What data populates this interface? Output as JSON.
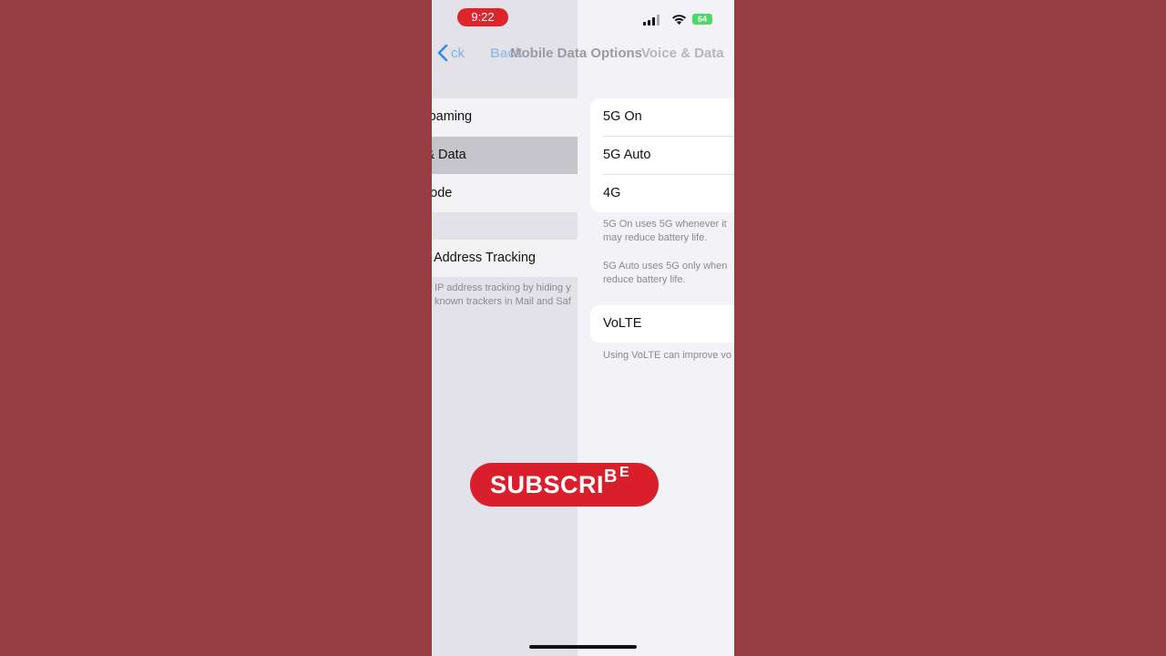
{
  "status_bar": {
    "time": "9:22",
    "battery": "64",
    "icons": [
      "signal-icon",
      "wifi-icon",
      "battery-icon"
    ]
  },
  "nav": {
    "back_label": "ck",
    "ghost_title": "Back",
    "title": "Mobile Data Options",
    "next_title": "Voice & Data"
  },
  "previous_page": {
    "rows": [
      "a Roaming",
      "ce & Data",
      "a Mode"
    ],
    "limit_ip_row": "it IP Address Tracking",
    "footnote_lines": [
      "IP address tracking by hiding y",
      "known trackers in Mail and Saf"
    ]
  },
  "voice_data": {
    "options": [
      "5G On",
      "5G Auto",
      "4G"
    ],
    "footnote_5g_on": [
      "5G On uses 5G whenever it",
      "may reduce battery life."
    ],
    "footnote_5g_auto": [
      "5G Auto uses 5G only when",
      "reduce battery life."
    ],
    "volte_label": "VoLTE",
    "volte_footnote": "Using VoLTE can improve vo"
  },
  "overlay": {
    "subscribe_main": "SUBSCRI",
    "subscribe_tail_b": "B",
    "subscribe_tail_e": "E"
  },
  "colors": {
    "background": "#963e44",
    "accent_blue": "#2f8cf0",
    "subscribe_red": "#d91f2b",
    "battery_green": "#4cd964"
  }
}
